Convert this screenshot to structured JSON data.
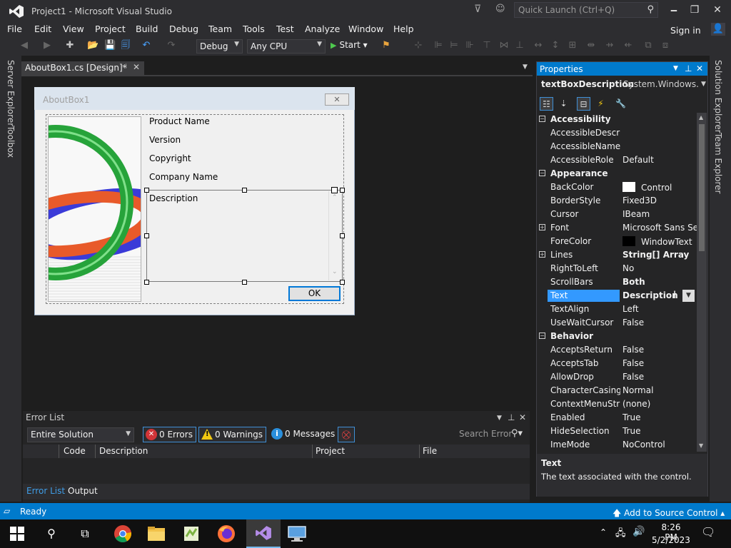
{
  "window": {
    "title": "Project1 - Microsoft Visual Studio",
    "quick_launch_placeholder": "Quick Launch (Ctrl+Q)",
    "minimize": "🗕",
    "restore": "❐",
    "close": "✕"
  },
  "menu": {
    "items": [
      "File",
      "Edit",
      "View",
      "Project",
      "Build",
      "Debug",
      "Team",
      "Tools",
      "Test",
      "Analyze",
      "Window",
      "Help"
    ],
    "sign_in": "Sign in"
  },
  "toolbar": {
    "configuration": "Debug",
    "platform": "Any CPU",
    "start": "Start"
  },
  "side_tabs": {
    "left": [
      "Server Explorer",
      "Toolbox"
    ],
    "right": [
      "Solution Explorer",
      "Team Explorer"
    ]
  },
  "document_tab": {
    "label": "AboutBox1.cs [Design]*"
  },
  "form": {
    "title": "AboutBox1",
    "labels": [
      "Product Name",
      "Version",
      "Copyright",
      "Company Name"
    ],
    "description": "Description",
    "ok_button": "OK"
  },
  "error_list": {
    "title": "Error List",
    "scope": "Entire Solution",
    "errors": "0 Errors",
    "warnings": "0 Warnings",
    "messages": "0 Messages",
    "search_placeholder": "Search Error",
    "columns": [
      "Code",
      "Description",
      "Project",
      "File"
    ],
    "tabs": [
      "Error List",
      "Output"
    ]
  },
  "properties": {
    "title": "Properties",
    "object_name": "textBoxDescription",
    "object_type": "System.Windows.Forms.TextBox",
    "rows": [
      {
        "type": "cat",
        "name": "Accessibility"
      },
      {
        "name": "AccessibleDescription",
        "value": ""
      },
      {
        "name": "AccessibleName",
        "value": ""
      },
      {
        "name": "AccessibleRole",
        "value": "Default"
      },
      {
        "type": "cat",
        "name": "Appearance"
      },
      {
        "name": "BackColor",
        "value": "Control",
        "swatch": "#ffffff"
      },
      {
        "name": "BorderStyle",
        "value": "Fixed3D"
      },
      {
        "name": "Cursor",
        "value": "IBeam"
      },
      {
        "name": "Font",
        "value": "Microsoft Sans Serif",
        "expand": true
      },
      {
        "name": "ForeColor",
        "value": "WindowText",
        "swatch": "#000000"
      },
      {
        "name": "Lines",
        "value": "String[] Array",
        "expand": true,
        "bold": true
      },
      {
        "name": "RightToLeft",
        "value": "No"
      },
      {
        "name": "ScrollBars",
        "value": "Both",
        "bold": true
      },
      {
        "name": "Text",
        "value": "Description",
        "bold": true,
        "selected": true
      },
      {
        "name": "TextAlign",
        "value": "Left"
      },
      {
        "name": "UseWaitCursor",
        "value": "False"
      },
      {
        "type": "cat",
        "name": "Behavior"
      },
      {
        "name": "AcceptsReturn",
        "value": "False"
      },
      {
        "name": "AcceptsTab",
        "value": "False"
      },
      {
        "name": "AllowDrop",
        "value": "False"
      },
      {
        "name": "CharacterCasing",
        "value": "Normal"
      },
      {
        "name": "ContextMenuStrip",
        "value": "(none)"
      },
      {
        "name": "Enabled",
        "value": "True"
      },
      {
        "name": "HideSelection",
        "value": "True"
      },
      {
        "name": "ImeMode",
        "value": "NoControl"
      }
    ],
    "desc_title": "Text",
    "desc_text": "The text associated with the control."
  },
  "status": {
    "ready": "Ready",
    "source_control": "Add to Source Control"
  },
  "taskbar": {
    "time": "8:26 PM",
    "date": "5/2/2023"
  }
}
